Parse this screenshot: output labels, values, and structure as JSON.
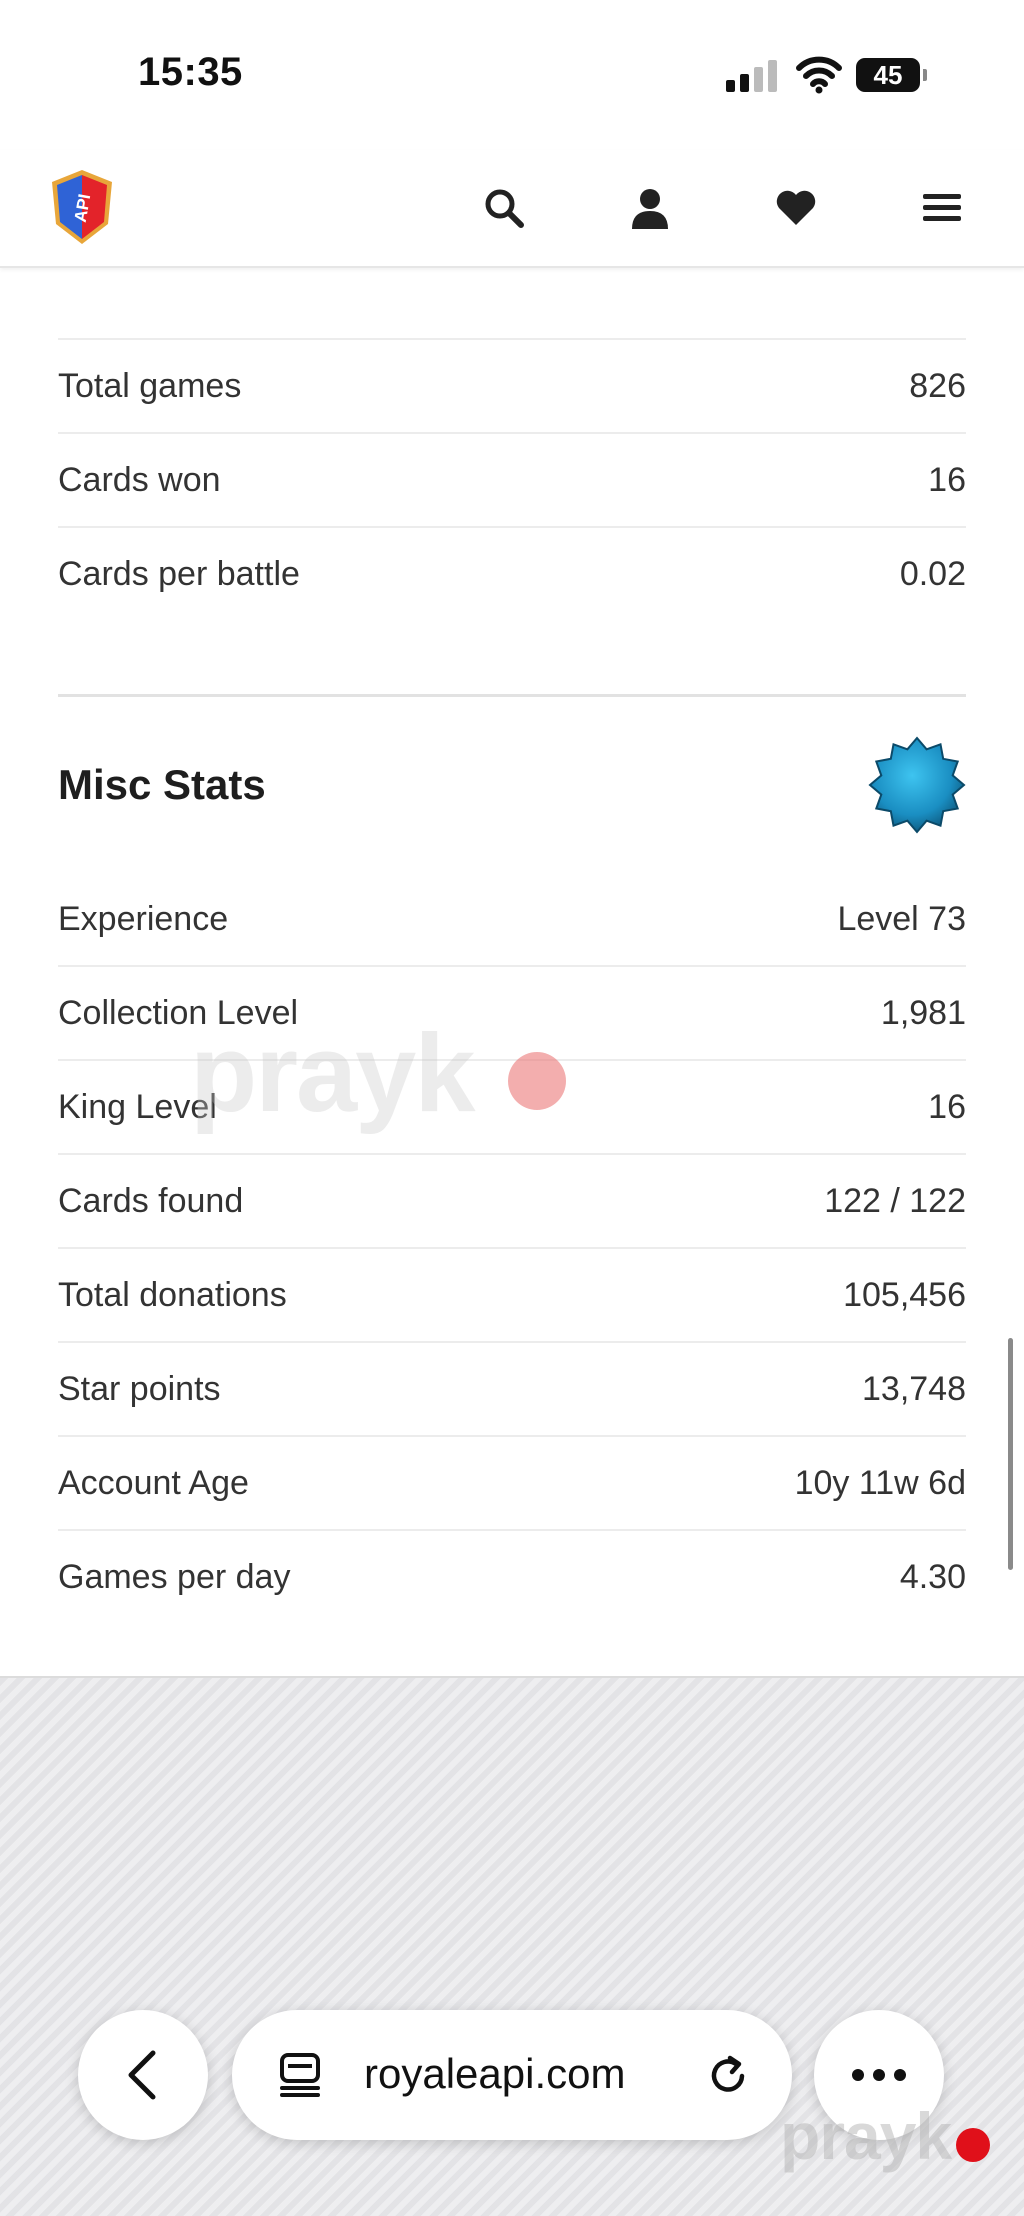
{
  "status_bar": {
    "time": "15:35",
    "battery": "45"
  },
  "header": {
    "logo_icon": "royaleapi-shield-logo",
    "icons": [
      "search-icon",
      "user-icon",
      "heart-icon",
      "menu-icon"
    ]
  },
  "stats_top": [
    {
      "label": "Total games",
      "value": "826"
    },
    {
      "label": "Cards won",
      "value": "16"
    },
    {
      "label": "Cards per battle",
      "value": "0.02"
    }
  ],
  "misc": {
    "title": "Misc Stats",
    "badge_icon": "blue-star-badge-icon",
    "rows": [
      {
        "label": "Experience",
        "value": "Level 73"
      },
      {
        "label": "Collection Level",
        "value": "1,981"
      },
      {
        "label": "King Level",
        "value": "16"
      },
      {
        "label": "Cards found",
        "value": "122 / 122"
      },
      {
        "label": "Total donations",
        "value": "105,456"
      },
      {
        "label": "Star points",
        "value": "13,748"
      },
      {
        "label": "Account Age",
        "value": "10y 11w 6d"
      },
      {
        "label": "Games per day",
        "value": "4.30"
      }
    ]
  },
  "browser": {
    "url": "royaleapi.com"
  },
  "watermark": "prayk"
}
